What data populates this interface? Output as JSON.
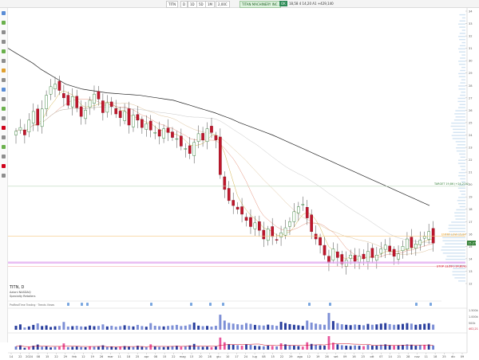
{
  "toolbar": {
    "symbol": "TITN",
    "interval": "D",
    "modes": [
      "1D",
      "5D",
      "1M"
    ],
    "selected_mode": "2,00C",
    "company": "TITAN MACHINERY INC.",
    "ok": "OK",
    "quote": "18,58  4  14,20  A1 +429,140"
  },
  "price_axis": {
    "ticks": [
      "34",
      "33",
      "32",
      "31",
      "30",
      "29",
      "28",
      "27",
      "26",
      "25",
      "24",
      "23",
      "22",
      "21",
      "20",
      "19",
      "18",
      "17",
      "16",
      "15",
      "14",
      "13",
      "12"
    ],
    "last_price": "15,27"
  },
  "levels": {
    "target": {
      "label": "TARGET 19,86 (+24,21%)",
      "color": "#2e7d32"
    },
    "entry": {
      "label": "ENTRY LOW 15,84",
      "color": "#f5a623"
    },
    "stop": {
      "label": "STOP 13,69 (-14,81%)",
      "color": "#d0021b"
    }
  },
  "info": {
    "title": "TITN, D",
    "line2": "Azioni NASDAQ",
    "line3": "Specialty Retailers",
    "line4": "ProRealTime Trading · Trends Views"
  },
  "volume_axis": {
    "ticks": [
      "1.500k",
      "1.000k",
      "500k"
    ],
    "last": "402,21"
  },
  "date_axis": {
    "labels": [
      "14",
      "22",
      "2024",
      "08",
      "15",
      "22",
      "29",
      "feb",
      "12",
      "19",
      "26",
      "mar",
      "11",
      "18",
      "25",
      "apr",
      "08",
      "15",
      "22",
      "mag",
      "13",
      "20",
      "28",
      "giu",
      "10",
      "17",
      "24",
      "lug",
      "08",
      "15",
      "22",
      "29",
      "ago",
      "12",
      "19",
      "26",
      "set",
      "09",
      "16",
      "23",
      "ott",
      "07",
      "14",
      "21",
      "28",
      "nov",
      "11",
      "18",
      "25",
      "dic",
      "09"
    ]
  },
  "chart_data": {
    "type": "candlestick",
    "symbol": "TITN",
    "interval": "D",
    "ylim": [
      12,
      34
    ],
    "series": [
      {
        "name": "price",
        "close": [
          24.3,
          24.6,
          24.0,
          25.2,
          25.9,
          24.8,
          26.1,
          27.2,
          27.9,
          28.1,
          27.6,
          27.0,
          26.4,
          27.1,
          26.2,
          25.5,
          26.0,
          26.8,
          27.3,
          26.9,
          25.8,
          26.6,
          26.3,
          25.7,
          25.4,
          25.9,
          24.8,
          25.6,
          25.2,
          24.6,
          24.9,
          24.4,
          24.2,
          23.9,
          24.5,
          24.2,
          23.8,
          23.7,
          23.1,
          22.9,
          22.5,
          23.4,
          24.1,
          23.6,
          24.5,
          24.2,
          23.6,
          20.8,
          19.6,
          18.7,
          18.3,
          18.0,
          17.6,
          17.1,
          16.6,
          16.9,
          16.3,
          15.6,
          16.4,
          15.8,
          15.5,
          16.1,
          16.5,
          17.0,
          17.8,
          18.2,
          18.4,
          17.3,
          16.2,
          15.6,
          15.1,
          14.3,
          13.7,
          14.8,
          14.1,
          13.6,
          13.9,
          14.3,
          13.8,
          14.2,
          14.0,
          14.6,
          14.1,
          14.3,
          14.8,
          15.1,
          14.6,
          14.2,
          14.4,
          15.0,
          15.6,
          14.9,
          15.2,
          15.5,
          15.8,
          16.2,
          15.27
        ],
        "ma200": [
          31.0,
          30.6,
          30.2,
          29.8,
          29.3,
          28.9,
          28.5,
          28.1,
          27.9,
          27.7,
          27.6,
          27.5,
          27.4,
          27.35,
          27.3,
          27.25,
          27.2,
          27.1,
          27.0,
          26.9,
          26.8,
          26.6,
          26.4,
          26.2,
          26.0,
          25.8,
          25.55,
          25.3,
          25.0,
          24.75,
          24.5,
          24.25,
          24.0,
          23.7,
          23.4,
          23.1,
          22.8,
          22.5,
          22.2,
          21.9,
          21.6,
          21.3,
          21.0,
          20.7,
          20.4,
          20.1,
          19.8,
          19.5,
          19.2,
          18.9,
          18.6,
          18.3
        ]
      },
      {
        "name": "volume",
        "values": [
          310,
          420,
          180,
          260,
          380,
          500,
          290,
          340,
          220,
          270,
          300,
          610,
          250,
          280,
          310,
          260,
          240,
          330,
          280,
          300,
          420,
          260,
          310,
          240,
          280,
          350,
          300,
          260,
          380,
          290,
          240,
          520,
          310,
          280,
          260,
          300,
          340,
          380,
          290,
          320,
          410,
          560,
          320,
          280,
          300,
          250,
          310,
          1180,
          720,
          540,
          480,
          430,
          390,
          520,
          460,
          380,
          350,
          330,
          400,
          360,
          310,
          620,
          520,
          440,
          390,
          350,
          300,
          720,
          560,
          480,
          420,
          390,
          1320,
          680,
          520,
          430,
          390,
          360,
          410,
          380,
          350,
          460,
          390,
          420,
          480,
          520,
          440,
          390,
          410,
          460,
          520,
          480,
          390,
          430,
          470,
          510,
          402
        ]
      }
    ],
    "levels": {
      "target": 19.86,
      "entry": 15.84,
      "stop": 13.69,
      "last": 15.27
    }
  }
}
